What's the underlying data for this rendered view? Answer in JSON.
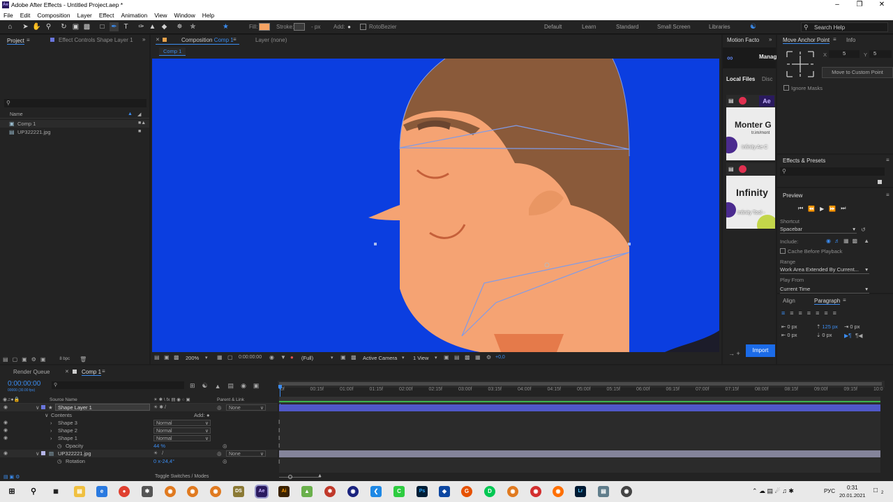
{
  "window": {
    "title": "Adobe After Effects - Untitled Project.aep *",
    "icon_label": "Ae"
  },
  "menu": [
    "File",
    "Edit",
    "Composition",
    "Layer",
    "Effect",
    "Animation",
    "View",
    "Window",
    "Help"
  ],
  "toolbar": {
    "fill_label": "Fill:",
    "fill_color": "#f5a363",
    "stroke_label": "Stroke:",
    "stroke_units": "- px",
    "add_label": "Add:",
    "rotobezier_label": "RotoBezier",
    "workspaces": [
      "Default",
      "Learn",
      "Standard",
      "Small Screen",
      "Libraries"
    ],
    "search_placeholder": "Search Help"
  },
  "project_panel": {
    "tab_project": "Project",
    "tab_effect_controls": "Effect Controls Shape Layer 1",
    "search_placeholder": "",
    "column_name": "Name",
    "items": [
      {
        "name": "Comp 1",
        "type": "comp"
      },
      {
        "name": "UP322221.jpg",
        "type": "footage"
      }
    ],
    "bpc": "8 bpc"
  },
  "composition": {
    "tab_label": "Composition",
    "tab_comp_name": "Comp 1",
    "layer_tab": "Layer (none)",
    "breadcrumb": "Comp 1",
    "zoom": "200%",
    "timecode": "0:00:00:00",
    "resolution": "(Full)",
    "camera": "Active Camera",
    "view": "1 View",
    "exposure": "+0,0",
    "bg_color": "#0b3ee0"
  },
  "motion_factory": {
    "tab": "Motion Facto",
    "subtab": "Manag",
    "local_files": "Local Files",
    "discover": "Disc",
    "card1_title": "Monter G",
    "card1_sub": "tr.im/mont",
    "card1_line": "Infinity Ae C",
    "card2_title": "Infinity",
    "card2_line": "Infinity Tool -",
    "import_label": "Import"
  },
  "move_anchor": {
    "tab": "Move Anchor Point",
    "info_tab": "Info",
    "x_label": "X",
    "x_value": "5",
    "y_label": "Y",
    "y_value": "5",
    "custom_button": "Move to Custom Point",
    "ignore_masks": "Ignore Masks"
  },
  "effects_presets": {
    "tab": "Effects & Presets"
  },
  "preview": {
    "tab": "Preview",
    "shortcut_label": "Shortcut",
    "shortcut_value": "Spacebar",
    "include_label": "Include:",
    "cache_label": "Cache Before Playback",
    "range_label": "Range",
    "range_value": "Work Area Extended By Current...",
    "play_from_label": "Play From",
    "play_from_value": "Current Time"
  },
  "paragraph": {
    "align_tab": "Align",
    "paragraph_tab": "Paragraph",
    "indent_left": "0 px",
    "indent_right": "0 px",
    "space_before": "125 px",
    "space_after": "0 px",
    "first_line": "0 px"
  },
  "timeline": {
    "render_queue_tab": "Render Queue",
    "comp_tab": "Comp 1",
    "current_time": "0:00:00:00",
    "frame_info": "00000 (30.00 fps)",
    "col_source": "Source Name",
    "col_parent": "Parent & Link",
    "layers": [
      {
        "name": "Shape Layer 1",
        "parent": "None"
      },
      {
        "name": "Contents",
        "add": "Add:"
      },
      {
        "name": "Shape 3",
        "mode": "Normal"
      },
      {
        "name": "Shape 2",
        "mode": "Normal"
      },
      {
        "name": "Shape 1",
        "mode": "Normal"
      },
      {
        "name": "Opacity",
        "value": "44 %"
      },
      {
        "name": "UP322221.jpg",
        "parent": "None"
      },
      {
        "name": "Rotation",
        "value": "0 x-24,4°"
      }
    ],
    "ruler": [
      "0f",
      "00:15f",
      "01:00f",
      "01:15f",
      "02:00f",
      "02:15f",
      "03:00f",
      "03:15f",
      "04:00f",
      "04:15f",
      "05:00f",
      "05:15f",
      "06:00f",
      "06:15f",
      "07:00f",
      "07:15f",
      "08:00f",
      "08:15f",
      "09:00f",
      "09:15f",
      "10:0"
    ],
    "toggle_label": "Toggle Switches / Modes"
  },
  "taskbar": {
    "time": "0:31",
    "date": "20.01.2021",
    "lang": "РУС",
    "notif": "2"
  }
}
